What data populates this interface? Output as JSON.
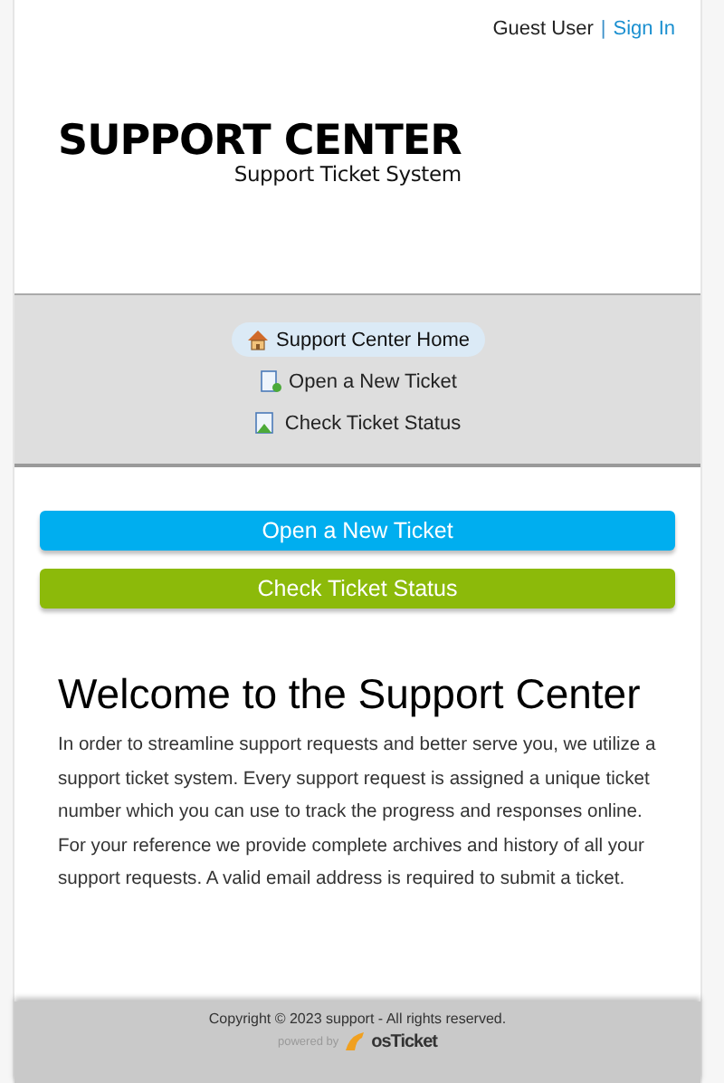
{
  "user_bar": {
    "user": "Guest User",
    "separator": "|",
    "sign_in": "Sign In"
  },
  "logo": {
    "title": "SUPPORT CENTER",
    "subtitle": "Support Ticket System"
  },
  "nav": [
    {
      "label": "Support Center Home",
      "kind": "home",
      "selected": true
    },
    {
      "label": "Open a New Ticket",
      "kind": "new",
      "selected": false
    },
    {
      "label": "Check Ticket Status",
      "kind": "status",
      "selected": false
    }
  ],
  "buttons": [
    {
      "label": "Open a New Ticket",
      "color": "#00aeef"
    },
    {
      "label": "Check Ticket Status",
      "color": "#8cba0a"
    }
  ],
  "welcome": {
    "heading": "Welcome to the Support Center",
    "body": "In order to streamline support requests and better serve you, we utilize a support ticket system. Every support request is assigned a unique ticket number which you can use to track the progress and responses online. For your reference we provide complete archives and history of all your support requests. A valid email address is required to submit a ticket."
  },
  "footer": {
    "copyright": "Copyright © 2023 support - All rights reserved.",
    "powered_by": "powered by",
    "brand": "osTicket"
  }
}
